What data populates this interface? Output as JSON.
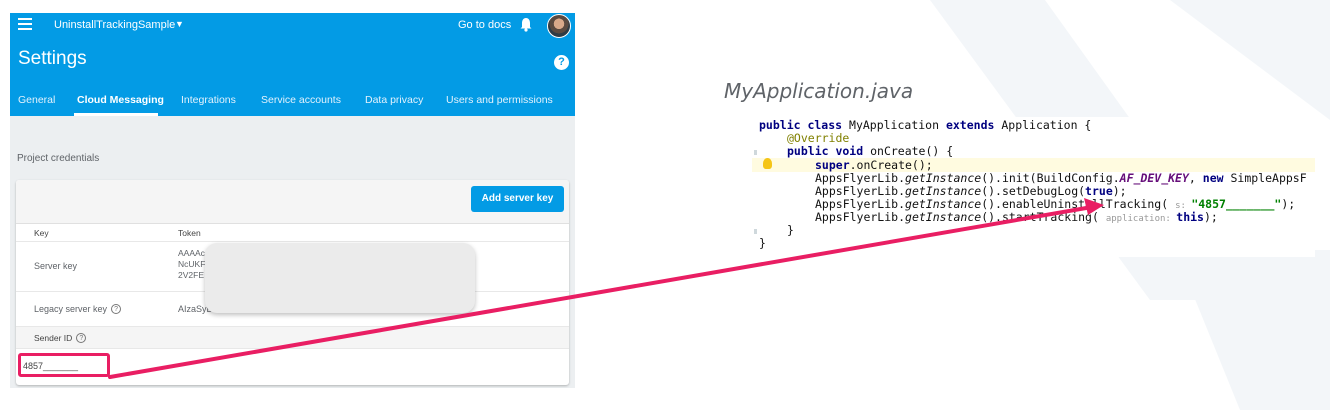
{
  "firebase": {
    "project_name": "UninstallTrackingSample",
    "go_to_docs": "Go to docs",
    "page_title": "Settings",
    "help_symbol": "?",
    "tabs": [
      {
        "label": "General"
      },
      {
        "label": "Cloud Messaging",
        "active": true
      },
      {
        "label": "Integrations"
      },
      {
        "label": "Service accounts"
      },
      {
        "label": "Data privacy"
      },
      {
        "label": "Users and permissions"
      }
    ],
    "section_title": "Project credentials",
    "add_server_key": "Add server key",
    "table": {
      "col_key": "Key",
      "col_token": "Token",
      "server_key_label": "Server key",
      "server_key_token": [
        "AAAAc",
        "NcUKF",
        "2V2FE"
      ],
      "legacy_label": "Legacy server key",
      "legacy_token": "AIzaSyB",
      "sender_id_label": "Sender ID",
      "sender_id_value": "4857_______"
    },
    "colors": {
      "header": "#039be5",
      "highlight": "#e91e63"
    }
  },
  "code_panel": {
    "filename": "MyApplication.java",
    "lines": {
      "l1": {
        "kw1": "public class ",
        "name": "MyApplication ",
        "kw2": "extends ",
        "rest": "Application {"
      },
      "l2": "@Override",
      "l3": {
        "kw": "public void ",
        "rest": "onCreate() {"
      },
      "l4": {
        "kw": "super",
        "rest": ".onCreate();"
      },
      "l5": {
        "a": "AppsFlyerLib.",
        "b": "getInstance",
        "c": "().init(BuildConfig.",
        "d": "AF_DEV_KEY",
        "e": ", ",
        "f": "new ",
        "g": "SimpleAppsF"
      },
      "l6": {
        "a": "AppsFlyerLib.",
        "b": "getInstance",
        "c": "().setDebugLog(",
        "d": "true",
        "e": ");"
      },
      "l7": {
        "a": "AppsFlyerLib.",
        "b": "getInstance",
        "c": "().enableUninstallTracking( ",
        "hint": "s: ",
        "str": "\"4857_______\"",
        "e": ");"
      },
      "l8": {
        "a": "AppsFlyerLib.",
        "b": "getInstance",
        "c": "().startTracking( ",
        "hint": "application: ",
        "d": "this",
        "e": ");"
      },
      "l9": "}",
      "l10": "}"
    }
  }
}
